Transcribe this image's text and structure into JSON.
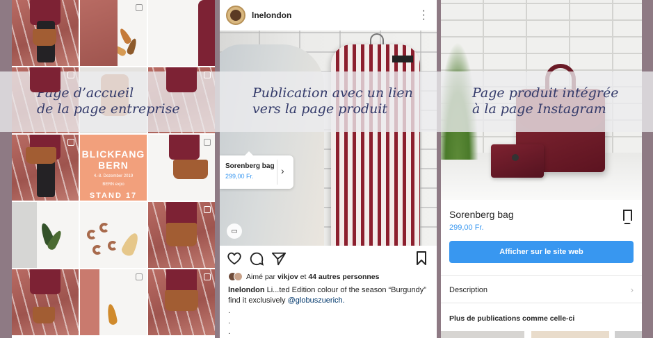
{
  "panels": {
    "grid": {
      "peach_tile": {
        "line1": "BLICKFANG",
        "line2": "BERN",
        "small1": "4.-8. Dezember 2019",
        "small2": "BERN expo",
        "line3": "STAND 17"
      }
    },
    "post": {
      "username": "lnelondon",
      "menu_icon": "more-vertical-icon",
      "product_tag": {
        "name": "Sorenberg bag",
        "price": "299,00 Fr."
      },
      "liked_prefix": "Aimé par",
      "liked_user": "vikjov",
      "liked_mid": "et",
      "liked_others": "44 autres personnes",
      "caption_user": "lnelondon",
      "caption_text": "Li...ted Edition colour of the season “Burgundy” find it exclusively",
      "caption_mention": "@globuszuerich.",
      "caption_dots": [
        ".",
        ".",
        "."
      ]
    },
    "product": {
      "name": "Sorenberg bag",
      "price": "299,00 Fr.",
      "button_label": "Afficher sur le site web",
      "description_label": "Description",
      "more_label": "Plus de publications comme celle-ci"
    }
  },
  "overlay": {
    "left": {
      "line1": "Page d’accueil",
      "line2": "de la page entreprise"
    },
    "middle": {
      "line1": "Publication avec un lien",
      "line2": "vers la page produit"
    },
    "right": {
      "line1": "Page produit intégrée",
      "line2": "à la page Instagram"
    }
  },
  "colors": {
    "accent_blue": "#3897f0",
    "overlay_text": "#333a6a",
    "background": "#8e7a84"
  }
}
